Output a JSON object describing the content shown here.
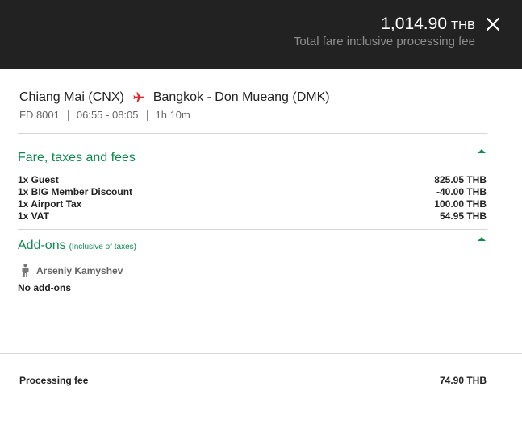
{
  "header": {
    "total_amount": "1,014.90",
    "total_currency": "THB",
    "total_note": "Total fare inclusive processing fee",
    "close_icon": "close-icon"
  },
  "flight": {
    "origin": "Chiang Mai (CNX)",
    "destination": "Bangkok - Don Mueang (DMK)",
    "plane_icon": "plane-icon",
    "flight_number": "FD 8001",
    "time": "06:55 - 08:05",
    "duration": "1h 10m"
  },
  "fare_section": {
    "title": "Fare, taxes and fees",
    "items": [
      {
        "label": "1x Guest",
        "amount": "825.05 THB"
      },
      {
        "label": "1x BIG Member Discount",
        "amount": "-40.00 THB"
      },
      {
        "label": "1x Airport Tax",
        "amount": "100.00 THB"
      },
      {
        "label": "1x VAT",
        "amount": "54.95 THB"
      }
    ]
  },
  "addons_section": {
    "title": "Add-ons",
    "subtitle": "(Inclusive of taxes)",
    "passenger_icon": "person-icon",
    "passenger_name": "Arseniy Kamyshev",
    "no_addons": "No add-ons"
  },
  "processing": {
    "label": "Processing fee",
    "amount": "74.90 THB"
  },
  "colors": {
    "header_bg": "#222222",
    "accent_green": "#0e8a4f",
    "airline_red": "#e3262f"
  }
}
